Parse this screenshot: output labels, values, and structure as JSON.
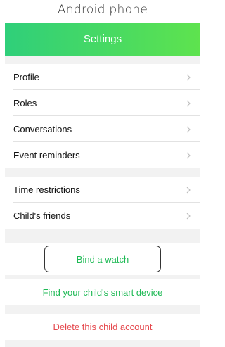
{
  "frame": {
    "title": "Android phone"
  },
  "header": {
    "title": "Settings",
    "gradient_start": "#2fcf7a",
    "gradient_end": "#5ee34e"
  },
  "sections": [
    {
      "items": [
        {
          "label": "Profile"
        },
        {
          "label": "Roles"
        },
        {
          "label": "Conversations"
        },
        {
          "label": "Event reminders"
        }
      ]
    },
    {
      "items": [
        {
          "label": "Time restrictions"
        },
        {
          "label": "Child's friends"
        }
      ]
    }
  ],
  "actions": {
    "bind_watch": "Bind a watch",
    "find_device": "Find your child's smart device",
    "delete_account": "Delete this child account"
  },
  "colors": {
    "accent_green": "#1db954",
    "danger_red": "#e5484d"
  },
  "icons": {
    "row_chevron": "chevron-right-icon"
  }
}
